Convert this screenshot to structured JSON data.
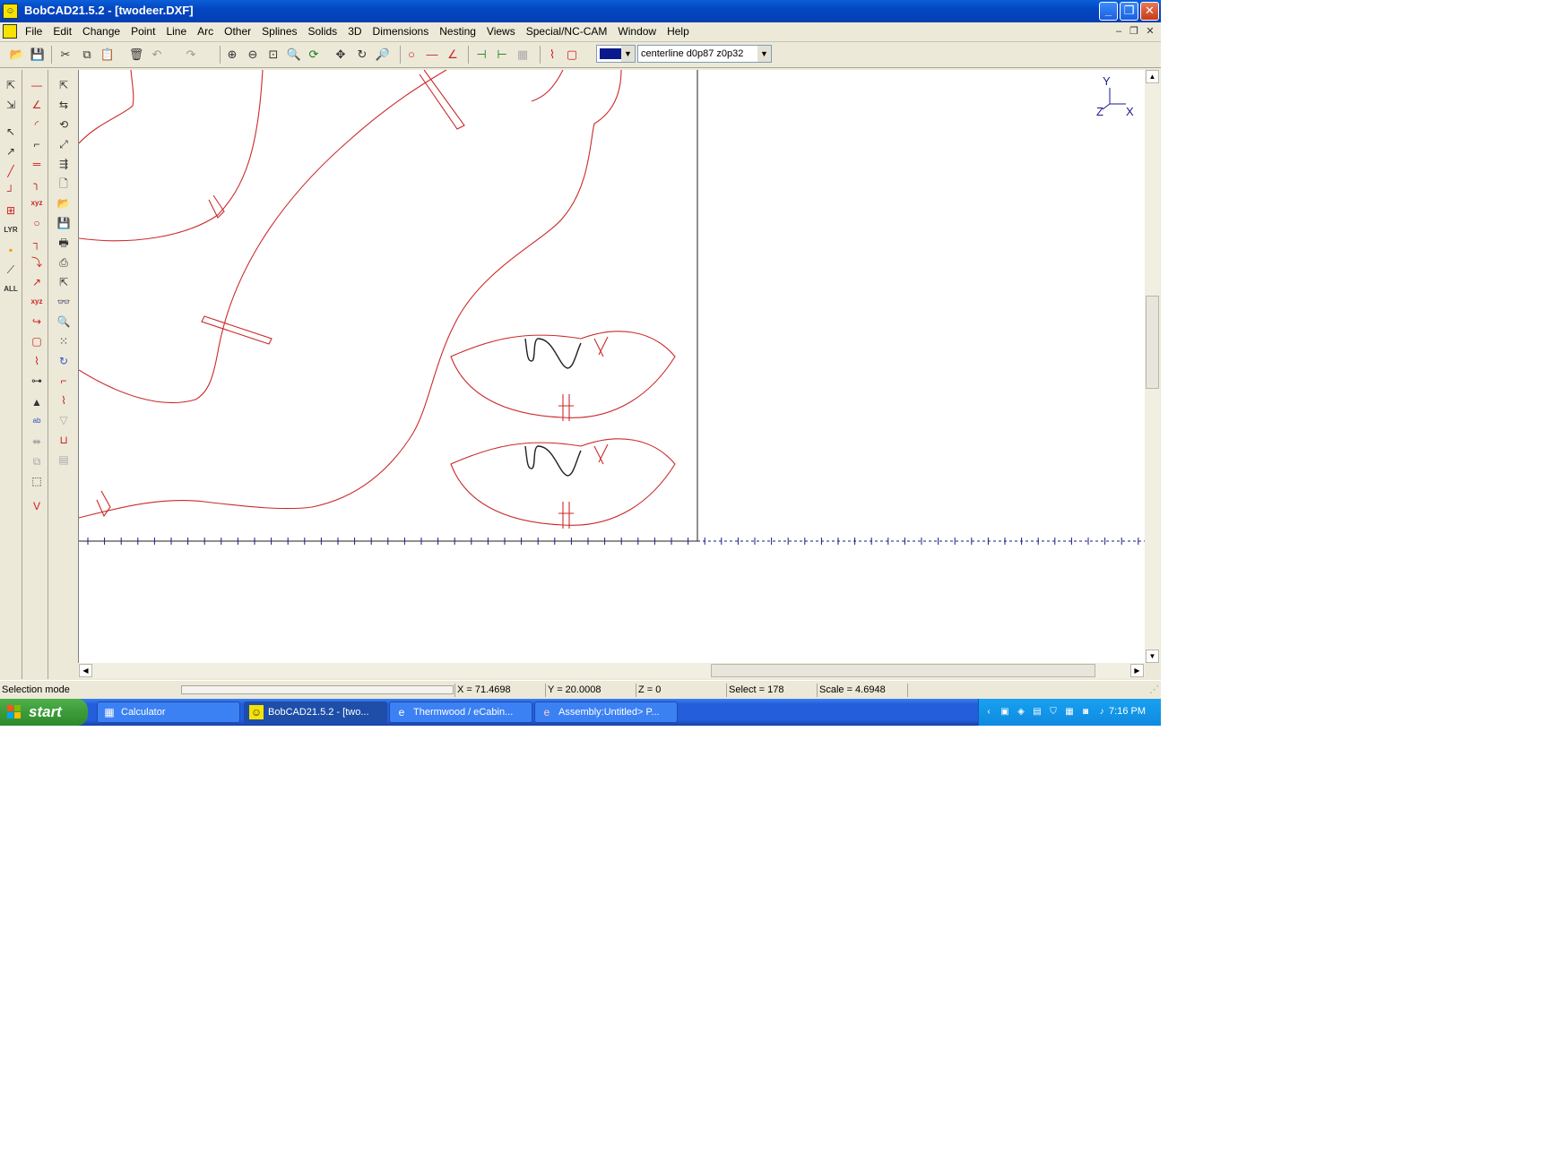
{
  "window": {
    "title": "BobCAD21.5.2 - [twodeer.DXF]",
    "min": "_",
    "max": "❐",
    "close": "✕"
  },
  "menu": [
    "File",
    "Edit",
    "Change",
    "Point",
    "Line",
    "Arc",
    "Other",
    "Splines",
    "Solids",
    "3D",
    "Dimensions",
    "Nesting",
    "Views",
    "Special/NC-CAM",
    "Window",
    "Help"
  ],
  "toolbar": {
    "layer": "centerline d0p87 z0p32",
    "color": "#0a1a8c"
  },
  "axis": {
    "y": "Y",
    "z": "Z",
    "x": "X"
  },
  "status": {
    "mode": "Selection mode",
    "x": "X = 71.4698",
    "y": "Y = 20.0008",
    "z": "Z = 0",
    "select": "Select = 178",
    "scale": "Scale = 4.6948"
  },
  "taskbar": {
    "start": "start",
    "tasks": [
      "Calculator",
      "BobCAD21.5.2 - [two...",
      "Thermwood / eCabin...",
      "Assembly:Untitled> P..."
    ],
    "clock": "7:16 PM"
  },
  "colors": {
    "path": "#cc2a2a",
    "part": "#222222",
    "ruler": "#1a1a8c"
  }
}
